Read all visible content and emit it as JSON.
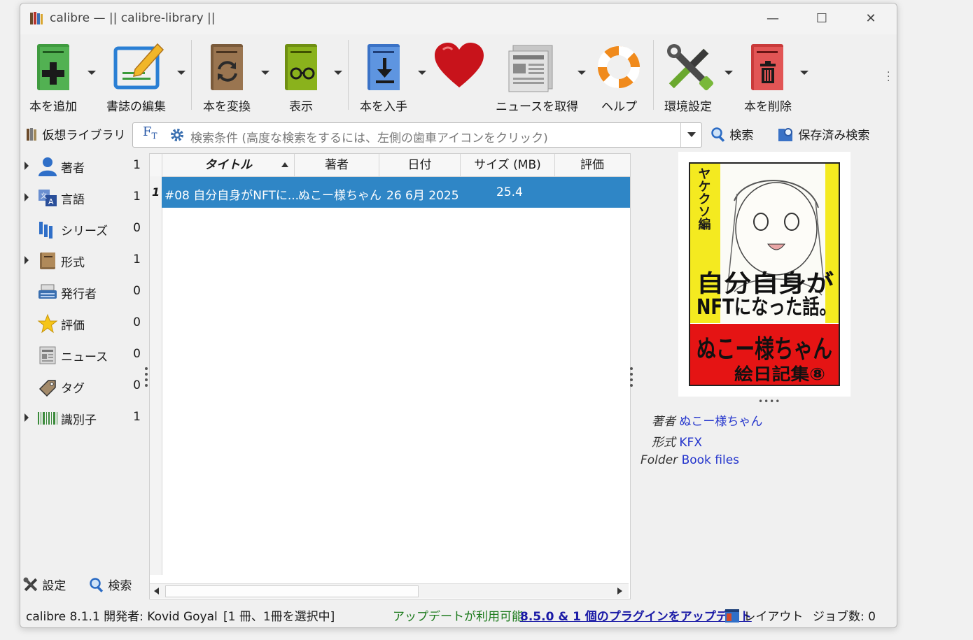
{
  "window": {
    "title": "calibre — || calibre-library ||",
    "controls": {
      "minimize": "—",
      "maximize": "☐",
      "close": "✕"
    }
  },
  "toolbar": {
    "items": [
      {
        "label": "本を追加",
        "icon": "add-book-icon",
        "has_menu": true
      },
      {
        "label": "書誌の編集",
        "icon": "edit-metadata-icon",
        "has_menu": true
      },
      {
        "label": "本を変換",
        "icon": "convert-book-icon",
        "has_menu": true
      },
      {
        "label": "表示",
        "icon": "view-book-icon",
        "has_menu": true
      },
      {
        "label": "本を入手",
        "icon": "get-books-icon",
        "has_menu": true
      },
      {
        "label": "",
        "icon": "donate-heart-icon",
        "has_menu": false
      },
      {
        "label": "ニュースを取得",
        "icon": "news-icon",
        "has_menu": true
      },
      {
        "label": "ヘルプ",
        "icon": "help-lifebuoy-icon",
        "has_menu": false
      },
      {
        "label": "環境設定",
        "icon": "preferences-tools-icon",
        "has_menu": true
      },
      {
        "label": "本を削除",
        "icon": "remove-book-icon",
        "has_menu": true
      }
    ]
  },
  "search": {
    "virtual_library": "仮想ライブラリ",
    "placeholder": "検索条件 (高度な検索をするには、左側の歯車アイコンをクリック)",
    "search_button": "検索",
    "saved_search_button": "保存済み検索"
  },
  "tag_browser": {
    "items": [
      {
        "label": "著者",
        "count": "1",
        "expandable": true,
        "icon": "author-icon"
      },
      {
        "label": "言語",
        "count": "1",
        "expandable": true,
        "icon": "language-icon"
      },
      {
        "label": "シリーズ",
        "count": "0",
        "expandable": false,
        "icon": "series-icon"
      },
      {
        "label": "形式",
        "count": "1",
        "expandable": true,
        "icon": "format-icon"
      },
      {
        "label": "発行者",
        "count": "0",
        "expandable": false,
        "icon": "publisher-icon"
      },
      {
        "label": "評価",
        "count": "0",
        "expandable": false,
        "icon": "rating-star-icon"
      },
      {
        "label": "ニュース",
        "count": "0",
        "expandable": false,
        "icon": "news-small-icon"
      },
      {
        "label": "タグ",
        "count": "0",
        "expandable": false,
        "icon": "tag-icon"
      },
      {
        "label": "識別子",
        "count": "1",
        "expandable": true,
        "icon": "barcode-icon"
      }
    ],
    "configure_label": "設定",
    "find_label": "検索"
  },
  "book_list": {
    "columns": [
      "タイトル",
      "著者",
      "日付",
      "サイズ (MB)",
      "評価"
    ],
    "sort_column": "タイトル",
    "rows": [
      {
        "num": "1",
        "title": "#08 自分自身がNFTに...",
        "author": "ぬこー様ちゃん",
        "date": "26  6月  2025",
        "size": "25.4",
        "rating": ""
      }
    ]
  },
  "book_details": {
    "author_key": "著者",
    "author_val": "ぬこー様ちゃん",
    "format_key": "形式",
    "format_val": "KFX",
    "folder_key": "Folder",
    "folder_val": "Book files"
  },
  "cover": {
    "vertical_text": "ヤケクソ編",
    "title_line1": "自分自身が",
    "title_line2": "NFTになった話。",
    "author_text": "ぬこー様ちゃん",
    "series_text": "絵日記集⑧"
  },
  "status": {
    "version": "calibre 8.1.1 開発者:  Kovid Goyal",
    "selection": "[1 冊、1冊を選択中]",
    "update_prefix": "アップデートが利用可能:",
    "update_link": "8.5.0 & 1 個のプラグインをアップデート",
    "layout": "レイアウト",
    "jobs": "ジョブ数: 0"
  },
  "colors": {
    "selection": "#2f86c6",
    "link": "#2233cc",
    "update_green": "#1c7a1c"
  }
}
